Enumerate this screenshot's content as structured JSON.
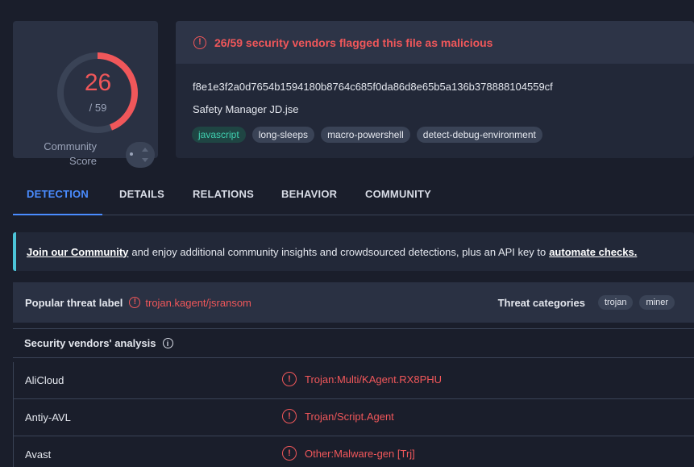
{
  "score": {
    "detections": "26",
    "total": "/ 59",
    "fraction": 0.4407,
    "community_label_1": "Community",
    "community_label_2": "Score",
    "colors": {
      "accent": "#f0575a",
      "track": "#3a4356"
    }
  },
  "file": {
    "banner": "26/59 security vendors flagged this file as malicious",
    "hash": "f8e1e3f2a0d7654b1594180b8764c685f0da86d8e65b5a136b378888104559cf",
    "name": "Safety Manager JD.jse",
    "tags": [
      "javascript",
      "long-sleeps",
      "macro-powershell",
      "detect-debug-environment"
    ]
  },
  "tabs": [
    {
      "label": "DETECTION",
      "active": true
    },
    {
      "label": "DETAILS"
    },
    {
      "label": "RELATIONS"
    },
    {
      "label": "BEHAVIOR"
    },
    {
      "label": "COMMUNITY"
    }
  ],
  "join": {
    "link1": "Join our Community",
    "middle": "and enjoy additional community insights and crowdsourced detections, plus an API key to",
    "link2": "automate checks."
  },
  "threat": {
    "title": "Popular threat label",
    "value": "trojan.kagent/jsransom",
    "categories_title": "Threat categories",
    "categories": [
      "trojan",
      "miner"
    ]
  },
  "vendors": {
    "title": "Security vendors' analysis",
    "rows": [
      {
        "name": "AliCloud",
        "result": "Trojan:Multi/KAgent.RX8PHU"
      },
      {
        "name": "Antiy-AVL",
        "result": "Trojan/Script.Agent"
      },
      {
        "name": "Avast",
        "result": "Other:Malware-gen [Trj]"
      }
    ]
  }
}
